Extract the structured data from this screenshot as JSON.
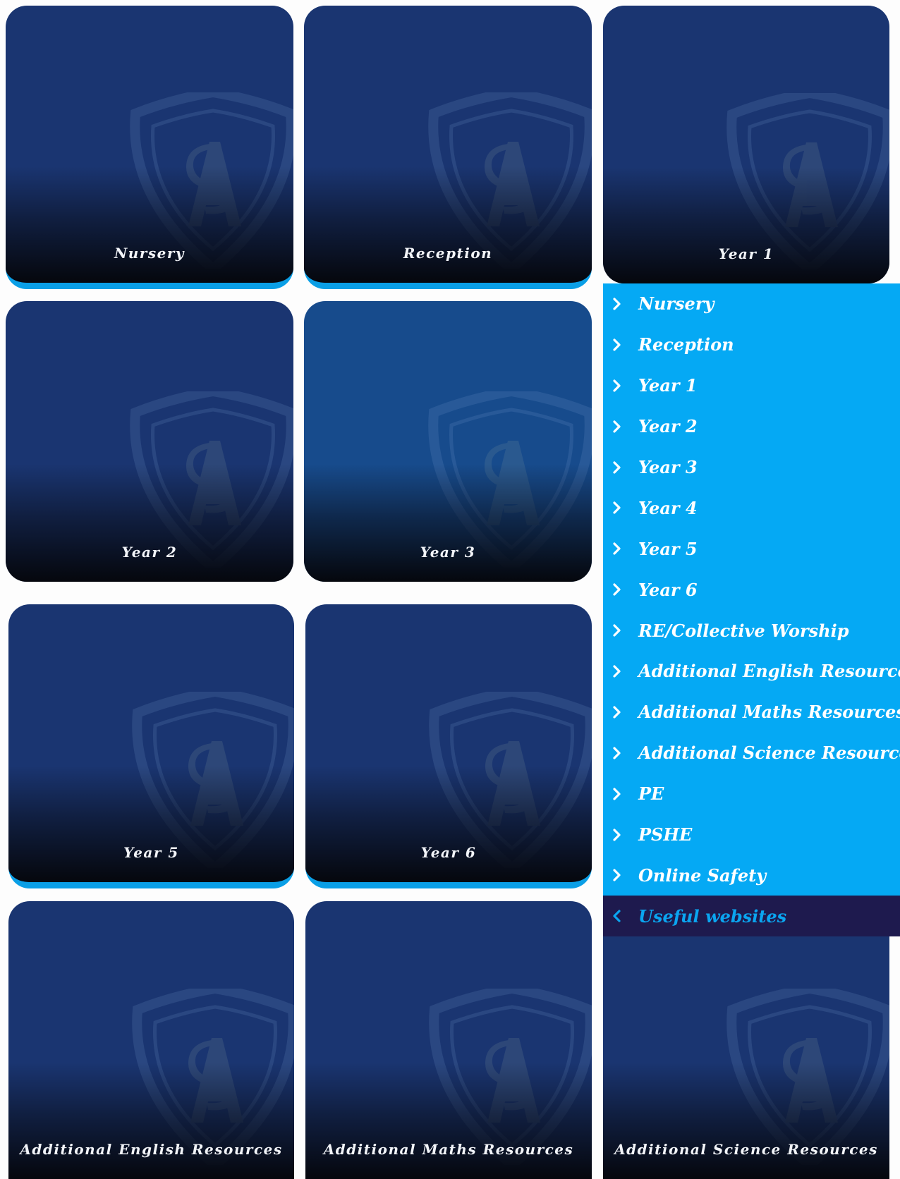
{
  "tiles": [
    {
      "label": "Nursery"
    },
    {
      "label": "Reception"
    },
    {
      "label": "Year 1"
    },
    {
      "label": "Year 2"
    },
    {
      "label": "Year 3"
    },
    {
      "label": "Year 5"
    },
    {
      "label": "Year 6"
    },
    {
      "label": "Additional English Resources"
    },
    {
      "label": "Additional Maths Resources"
    },
    {
      "label": "Additional Science Resources"
    }
  ],
  "menu": {
    "items": [
      {
        "label": "Nursery"
      },
      {
        "label": "Reception"
      },
      {
        "label": "Year 1"
      },
      {
        "label": "Year 2"
      },
      {
        "label": "Year 3"
      },
      {
        "label": "Year 4"
      },
      {
        "label": "Year 5"
      },
      {
        "label": "Year 6"
      },
      {
        "label": "RE/Collective Worship"
      },
      {
        "label": "Additional English Resources"
      },
      {
        "label": "Additional Maths Resources"
      },
      {
        "label": "Additional Science Resources"
      },
      {
        "label": "PE"
      },
      {
        "label": "PSHE"
      },
      {
        "label": "Online Safety"
      },
      {
        "label": "Useful websites",
        "active": true
      }
    ]
  },
  "colors": {
    "tile_blue": "#1a3571",
    "accent_cyan": "#05a9f4",
    "active_item_bg": "#1e1a4e"
  },
  "icons": {
    "tile_watermark": "school-crest-icon",
    "menu_item": "chevron-right-icon",
    "menu_active": "chevron-left-icon"
  }
}
